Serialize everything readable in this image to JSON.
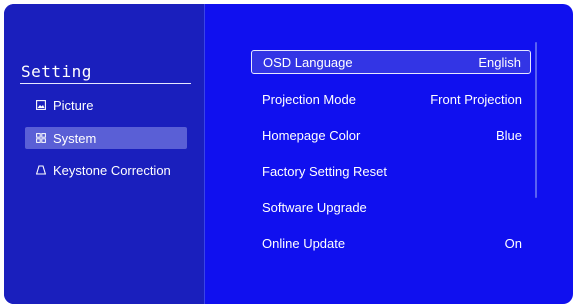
{
  "sidebar": {
    "title": "Setting",
    "items": [
      {
        "label": "Picture",
        "icon": "picture-icon",
        "selected": false
      },
      {
        "label": "System",
        "icon": "grid-icon",
        "selected": true
      },
      {
        "label": "Keystone Correction",
        "icon": "keystone-icon",
        "selected": false
      }
    ]
  },
  "main": {
    "rows": [
      {
        "label": "OSD Language",
        "value": "English",
        "selected": true
      },
      {
        "label": "Projection Mode",
        "value": "Front Projection",
        "selected": false
      },
      {
        "label": "Homepage Color",
        "value": "Blue",
        "selected": false
      },
      {
        "label": "Factory Setting Reset",
        "value": "",
        "selected": false
      },
      {
        "label": "Software Upgrade",
        "value": "",
        "selected": false
      },
      {
        "label": "Online Update",
        "value": "On",
        "selected": false
      }
    ]
  },
  "colors": {
    "screen_background": "#1010ef",
    "sidebar_background": "#1a1fbd",
    "sidebar_selected": "#5a5fd6",
    "text": "#ffffff"
  }
}
